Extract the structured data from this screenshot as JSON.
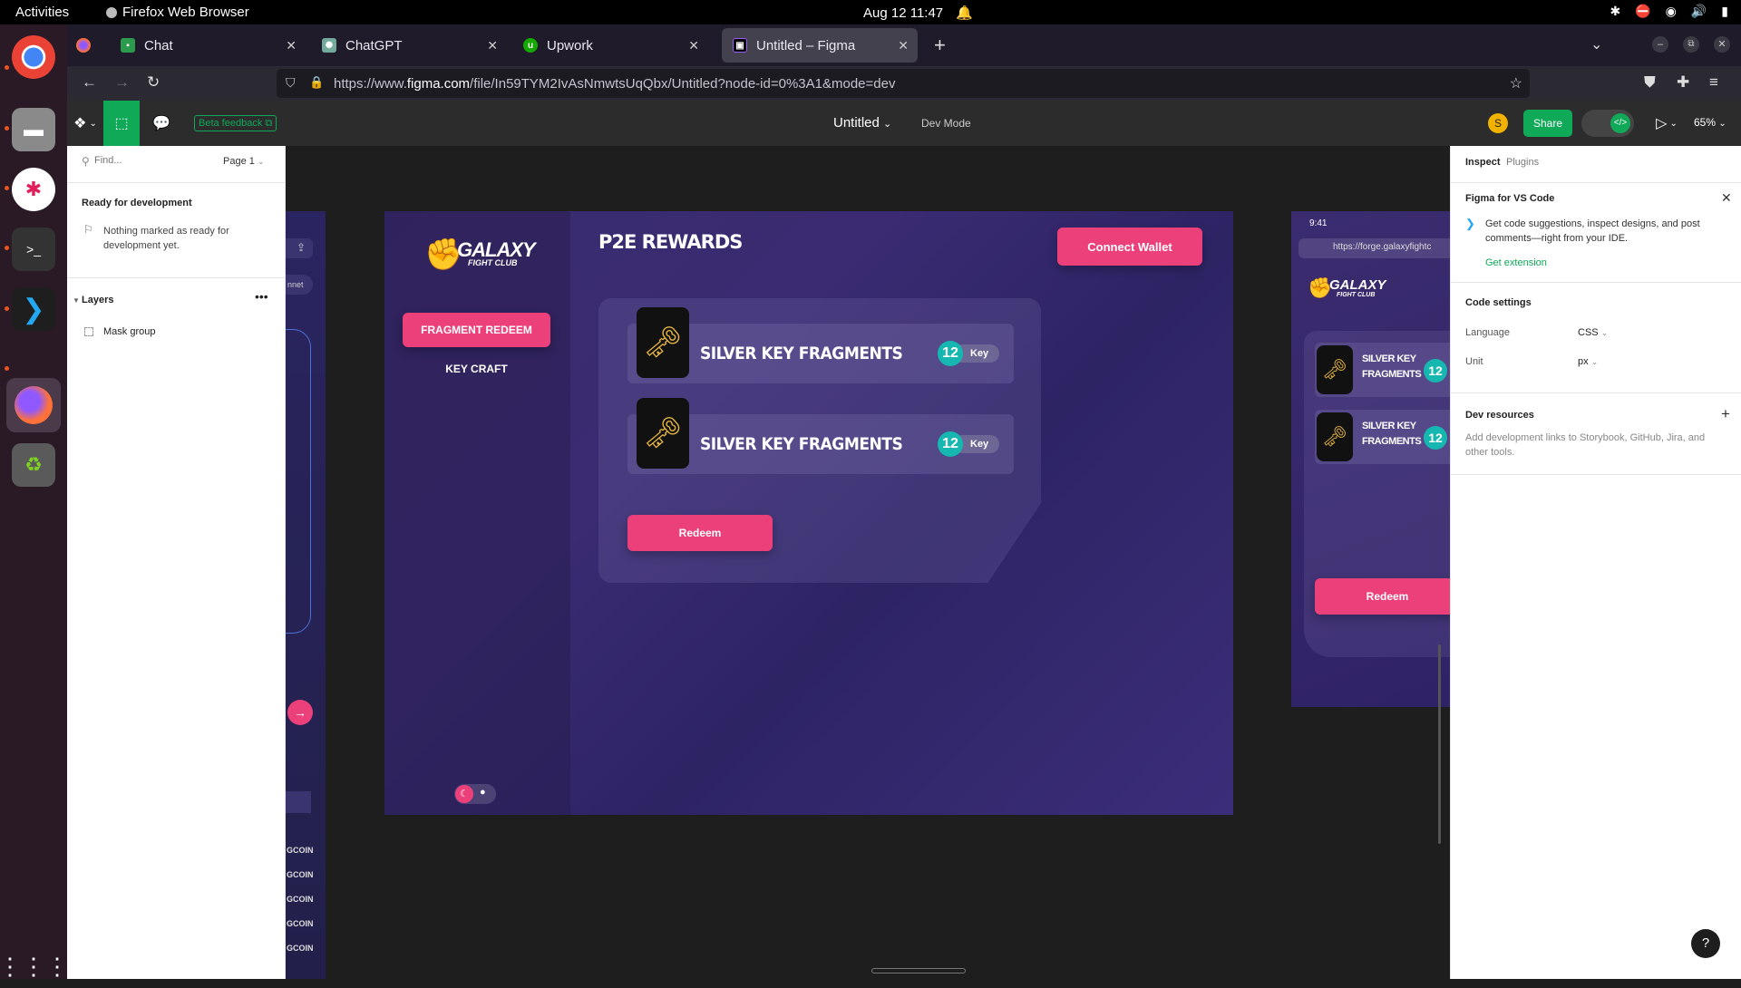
{
  "os": {
    "activities": "Activities",
    "app_name": "Firefox Web Browser",
    "clock": "Aug 12  11:47"
  },
  "browser": {
    "tabs": [
      {
        "label": "Chat"
      },
      {
        "label": "ChatGPT"
      },
      {
        "label": "Upwork"
      },
      {
        "label": "Untitled – Figma"
      }
    ],
    "url_prefix": "https://www.",
    "url_domain": "figma.com",
    "url_rest": "/file/In59TYM2IvAsNmwtsUqQbx/Untitled?node-id=0%3A1&mode=dev"
  },
  "figma": {
    "beta_feedback": "Beta feedback",
    "file_title": "Untitled",
    "mode_label": "Dev Mode",
    "avatar_initial": "S",
    "share_label": "Share",
    "zoom": "65%",
    "left": {
      "search_placeholder": "Find...",
      "page": "Page 1",
      "ready_heading": "Ready for development",
      "ready_empty": "Nothing marked as ready for development yet.",
      "layers_heading": "Layers",
      "layer_item": "Mask group"
    },
    "right": {
      "tab_inspect": "Inspect",
      "tab_plugins": "Plugins",
      "vscode_title": "Figma for VS Code",
      "vscode_desc": "Get code suggestions, inspect designs, and post comments—right from your IDE.",
      "vscode_link": "Get extension",
      "code_settings": "Code settings",
      "language_label": "Language",
      "language_value": "CSS",
      "unit_label": "Unit",
      "unit_value": "px",
      "dev_resources": "Dev resources",
      "dev_resources_desc": "Add development links to Storybook, GitHub, Jira, and other tools."
    },
    "help": "?"
  },
  "design": {
    "logo_main": "GALAXY",
    "logo_sub": "FIGHT CLUB",
    "nav_fragment_redeem": "FRAGMENT REDEEM",
    "nav_key_craft": "KEY CRAFT",
    "page_title": "P2E REWARDS",
    "connect_wallet": "Connect Wallet",
    "rewards": [
      {
        "name": "SILVER KEY FRAGMENTS",
        "count": "12",
        "unit": "Key"
      },
      {
        "name": "SILVER KEY FRAGMENTS",
        "count": "12",
        "unit": "Key"
      }
    ],
    "redeem": "Redeem",
    "left_partial": {
      "net_label": "nnet",
      "coin_rows": [
        "GCOIN",
        "GCOIN",
        "GCOIN",
        "GCOIN",
        "GCOIN"
      ]
    },
    "mobile": {
      "time": "9:41",
      "url": "https://forge.galaxyfightc",
      "logo_main": "GALAXY",
      "logo_sub": "FIGHT CLUB",
      "rewards": [
        {
          "name_line1": "SILVER KEY",
          "name_line2": "FRAGMENTS",
          "count": "12"
        },
        {
          "name_line1": "SILVER KEY",
          "name_line2": "FRAGMENTS",
          "count": "12"
        }
      ],
      "redeem": "Redeem"
    }
  }
}
